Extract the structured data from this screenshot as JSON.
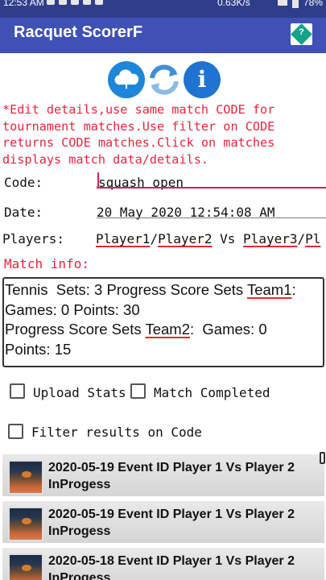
{
  "status_bar": {
    "time": "12:53 AM",
    "speed": "0.63K/s",
    "battery": "78%"
  },
  "app_bar": {
    "title": "Racquet ScorerF",
    "help_icon": "help-diamond-icon",
    "help_symbol": "?"
  },
  "toolbar_icons": [
    "cloud-upload-icon",
    "sync-icon",
    "info-icon"
  ],
  "instructions": "*Edit details,use same match CODE for tournament matches.Use filter on CODE returns CODE matches.Click on matches displays match data/details.",
  "form": {
    "code_label": "Code:",
    "code_value": "squash open",
    "date_label": "Date:",
    "date_value": "20 May 2020 12:54:08 AM",
    "players_label": "Players:",
    "player1": "Player1",
    "sep1": "/",
    "player2": "Player2",
    "vs": " Vs ",
    "player3": "Player3",
    "sep2": "/",
    "player4_partial": "Pl"
  },
  "match_info": {
    "label": "Match info:",
    "line1_prefix": "Tennis  Sets: 3 Progress Score Sets ",
    "team1": "Team1",
    "line1_suffix": ":",
    "line2": "Games: 0 Points: 30",
    "line3_prefix": "Progress Score Sets ",
    "team2": "Team2",
    "line3_suffix": ":  Games: 0",
    "line4": "Points: 15"
  },
  "options": {
    "upload_stats": "Upload Stats",
    "match_completed": "Match Completed",
    "filter_results": "Filter results on Code"
  },
  "matches": [
    {
      "line1": "2020-05-19 Event ID Player 1 Vs Player 2",
      "line2": "InProgess"
    },
    {
      "line1": "2020-05-19 Event ID Player 1 Vs Player 2",
      "line2": "InProgess"
    },
    {
      "line1": "2020-05-18 Event ID Player 1 Vs Player 2",
      "line2": "InProgess"
    }
  ],
  "colors": {
    "app_bar": "#3f51b5",
    "status_bar": "#2f3e8a",
    "instructions": "#e8243d",
    "accent": "#d81b60"
  }
}
